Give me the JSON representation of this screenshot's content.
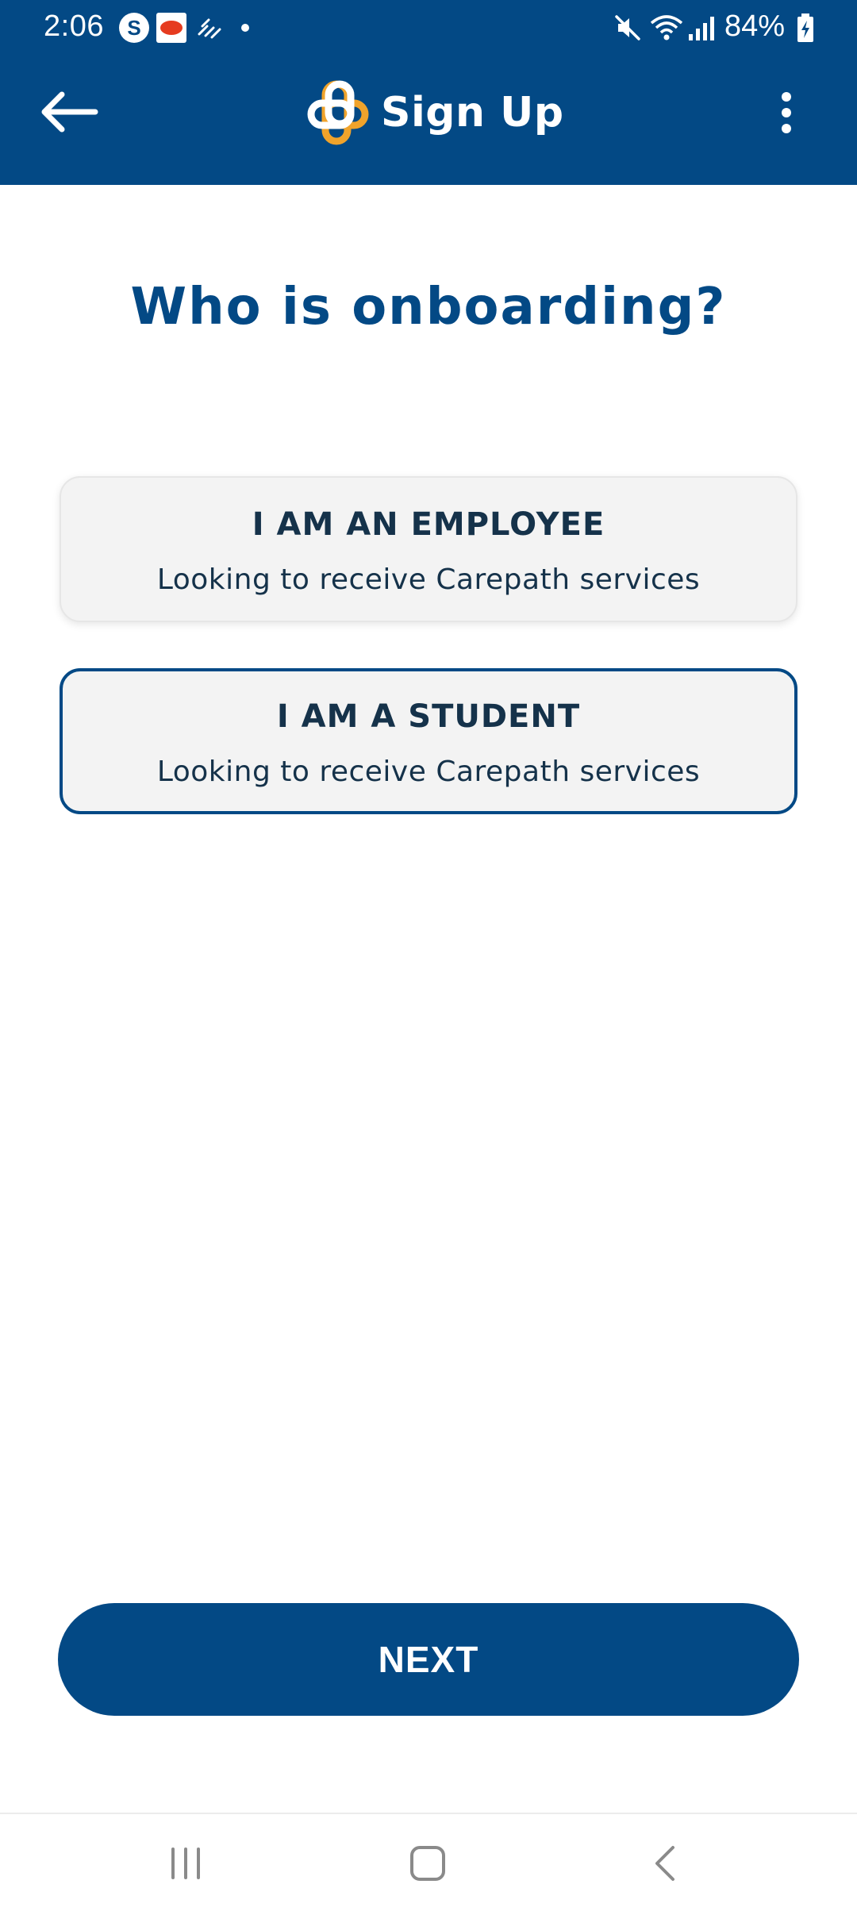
{
  "status_bar": {
    "time": "2:06",
    "skype_letter": "S",
    "battery": "84%"
  },
  "header": {
    "title": "Sign Up",
    "back_icon": "arrow-left-icon",
    "menu_icon": "more-vert-icon",
    "logo_icon": "carepath-logo-icon"
  },
  "main": {
    "heading": "Who is onboarding?",
    "options": [
      {
        "title": "I AM AN EMPLOYEE",
        "subtitle": "Looking to receive Carepath services",
        "selected": false
      },
      {
        "title": "I AM A STUDENT",
        "subtitle": "Looking to receive Carepath services",
        "selected": true
      }
    ],
    "next_label": "NEXT"
  },
  "nav_bar": {
    "recents_icon": "recents-icon",
    "home_icon": "home-icon",
    "back_icon": "nav-back-icon"
  },
  "colors": {
    "primary": "#034985",
    "accent": "#f0a32b",
    "text_dark": "#15324a",
    "card_bg": "#f3f3f3"
  }
}
